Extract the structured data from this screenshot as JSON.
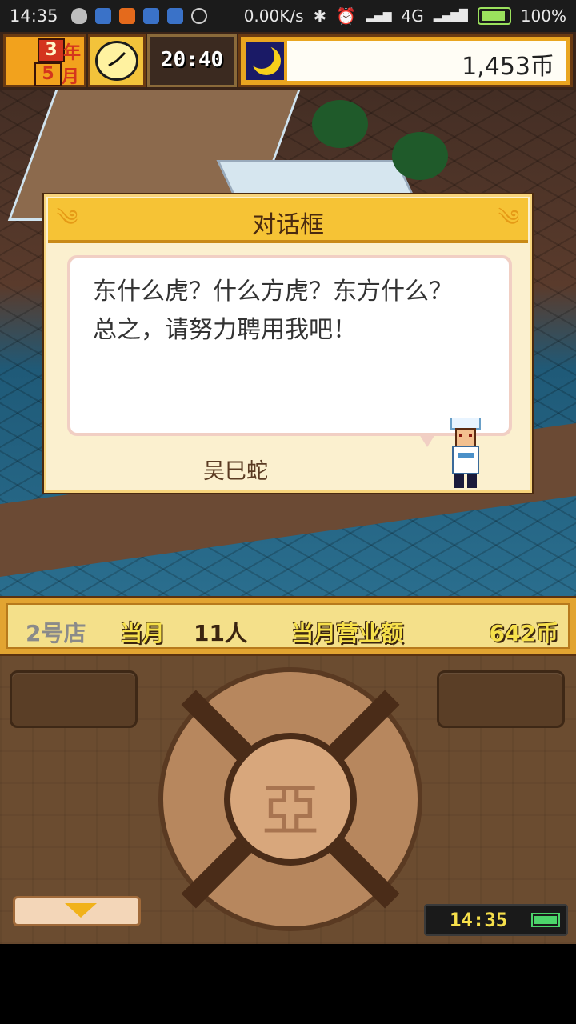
{
  "status_bar": {
    "time": "14:35",
    "network_speed": "0.00K/s",
    "network_type": "4G",
    "battery": "100%"
  },
  "hud": {
    "year_number": "3",
    "year_unit": "年",
    "month_number": "5",
    "month_unit": "月",
    "game_time": "20:40",
    "money": "1,453币"
  },
  "dialog": {
    "title": "对话框",
    "message": "东什么虎？什么方虎？东方什么？\n总之，请努力聘用我吧！",
    "speaker": "吴巳蛇"
  },
  "store_bar": {
    "store_name": "2号店",
    "month_label": "当月",
    "visitors": "11人",
    "sales_label": "当月营业额",
    "sales_value": "642币"
  },
  "panel": {
    "clock": "14:35",
    "dpad_glyph": "亞"
  },
  "colors": {
    "hud_orange": "#e9a520",
    "dialog_title_bar": "#f6c335",
    "store_bar": "#e2a431",
    "panel_brown": "#6b4c30"
  }
}
